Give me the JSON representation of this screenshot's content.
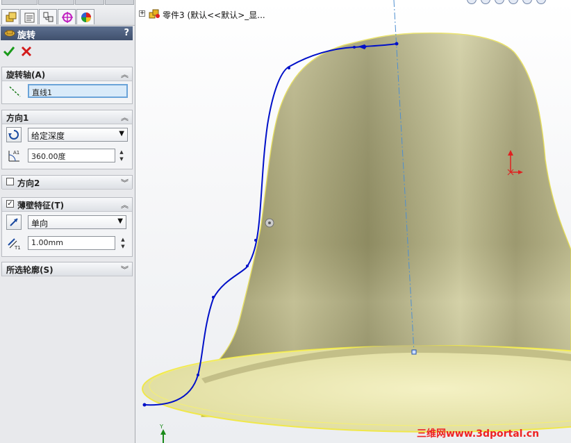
{
  "tabs": [
    {
      "name": "feature-manager-tab",
      "icon": "feature-tree-icon"
    },
    {
      "name": "property-manager-tab",
      "icon": "property-manager-icon"
    },
    {
      "name": "configuration-manager-tab",
      "icon": "configuration-icon"
    },
    {
      "name": "dimxpert-tab",
      "icon": "dimxpert-icon"
    },
    {
      "name": "display-manager-tab",
      "icon": "display-manager-icon"
    }
  ],
  "property_manager": {
    "title": "旋转",
    "help": "?",
    "ok_icon": "check-icon",
    "cancel_icon": "x-icon"
  },
  "groups": {
    "axis": {
      "title": "旋转轴(A)",
      "value": "直线1"
    },
    "direction1": {
      "title": "方向1",
      "type_value": "给定深度",
      "angle_value": "360.00度"
    },
    "direction2": {
      "title": "方向2",
      "checked": false
    },
    "thin_feature": {
      "title": "薄壁特征(T)",
      "checked": true,
      "check_mark": "✓",
      "type_value": "单向",
      "thickness_value": "1.00mm"
    },
    "selected_contours": {
      "title": "所选轮廓(S)"
    }
  },
  "viewport": {
    "tree_expand": "+",
    "tree_label": "零件3  (默认<<默认>_显...",
    "triad_axis_label": "Y",
    "watermark": "三维网www.3dportal.cn"
  },
  "colors": {
    "title_bar": "#4b5c7c",
    "sketch_profile": "#0010c8",
    "centerline": "#4e8fd0",
    "model_body": "#a9a574",
    "thin_edge": "#ecec50",
    "ok_green": "#1a9a1a",
    "cancel_red": "#d21a1a",
    "watermark": "#e22222"
  }
}
